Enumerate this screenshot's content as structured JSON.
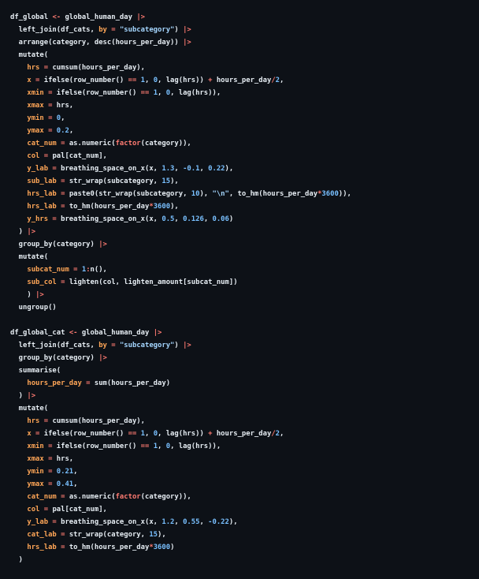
{
  "colors": {
    "background": "#0d1117",
    "plain": "#e6edf3",
    "argument": "#ffa657",
    "operator": "#ff7b72",
    "number": "#79c0ff",
    "string": "#a5d6ff",
    "function": "#d2a8ff"
  },
  "code": {
    "lines": [
      [
        [
          "var",
          "df_global "
        ],
        [
          "op",
          "<-"
        ],
        [
          "plain",
          " global_human_day "
        ],
        [
          "op",
          "|>"
        ]
      ],
      [
        [
          "plain",
          "  left_join(df_cats, "
        ],
        [
          "arg",
          "by"
        ],
        [
          "op",
          " = "
        ],
        [
          "str",
          "\"subcategory\""
        ],
        [
          "plain",
          ") "
        ],
        [
          "op",
          "|>"
        ]
      ],
      [
        [
          "plain",
          "  arrange(category, desc(hours_per_day)) "
        ],
        [
          "op",
          "|>"
        ]
      ],
      [
        [
          "plain",
          "  mutate("
        ]
      ],
      [
        [
          "plain",
          "    "
        ],
        [
          "arg",
          "hrs"
        ],
        [
          "op",
          " = "
        ],
        [
          "plain",
          "cumsum(hours_per_day),"
        ]
      ],
      [
        [
          "plain",
          "    "
        ],
        [
          "arg",
          "x"
        ],
        [
          "op",
          " = "
        ],
        [
          "plain",
          "ifelse(row_number() "
        ],
        [
          "op",
          "=="
        ],
        [
          "plain",
          " "
        ],
        [
          "num",
          "1"
        ],
        [
          "plain",
          ", "
        ],
        [
          "num",
          "0"
        ],
        [
          "plain",
          ", lag(hrs)) "
        ],
        [
          "op",
          "+"
        ],
        [
          "plain",
          " hours_per_day"
        ],
        [
          "op",
          "/"
        ],
        [
          "num",
          "2"
        ],
        [
          "plain",
          ","
        ]
      ],
      [
        [
          "plain",
          "    "
        ],
        [
          "arg",
          "xmin"
        ],
        [
          "op",
          " = "
        ],
        [
          "plain",
          "ifelse(row_number() "
        ],
        [
          "op",
          "=="
        ],
        [
          "plain",
          " "
        ],
        [
          "num",
          "1"
        ],
        [
          "plain",
          ", "
        ],
        [
          "num",
          "0"
        ],
        [
          "plain",
          ", lag(hrs)),"
        ]
      ],
      [
        [
          "plain",
          "    "
        ],
        [
          "arg",
          "xmax"
        ],
        [
          "op",
          " = "
        ],
        [
          "plain",
          "hrs,"
        ]
      ],
      [
        [
          "plain",
          "    "
        ],
        [
          "arg",
          "ymin"
        ],
        [
          "op",
          " = "
        ],
        [
          "num",
          "0"
        ],
        [
          "plain",
          ","
        ]
      ],
      [
        [
          "plain",
          "    "
        ],
        [
          "arg",
          "ymax"
        ],
        [
          "op",
          " = "
        ],
        [
          "num",
          "0.2"
        ],
        [
          "plain",
          ","
        ]
      ],
      [
        [
          "plain",
          "    "
        ],
        [
          "arg",
          "cat_num"
        ],
        [
          "op",
          " = "
        ],
        [
          "plain",
          "as.numeric("
        ],
        [
          "op",
          "factor"
        ],
        [
          "plain",
          "(category)),"
        ]
      ],
      [
        [
          "plain",
          "    "
        ],
        [
          "arg",
          "col"
        ],
        [
          "op",
          " = "
        ],
        [
          "plain",
          "pal[cat_num],"
        ]
      ],
      [
        [
          "plain",
          "    "
        ],
        [
          "arg",
          "y_lab"
        ],
        [
          "op",
          " = "
        ],
        [
          "plain",
          "breathing_space_on_x(x, "
        ],
        [
          "num",
          "1.3"
        ],
        [
          "plain",
          ", "
        ],
        [
          "num",
          "-0.1"
        ],
        [
          "plain",
          ", "
        ],
        [
          "num",
          "0.22"
        ],
        [
          "plain",
          "),"
        ]
      ],
      [
        [
          "plain",
          "    "
        ],
        [
          "arg",
          "sub_lab"
        ],
        [
          "op",
          " = "
        ],
        [
          "plain",
          "str_wrap(subcategory, "
        ],
        [
          "num",
          "15"
        ],
        [
          "plain",
          "),"
        ]
      ],
      [
        [
          "plain",
          "    "
        ],
        [
          "arg",
          "hrs_lab"
        ],
        [
          "op",
          " = "
        ],
        [
          "plain",
          "paste0(str_wrap(subcategory, "
        ],
        [
          "num",
          "10"
        ],
        [
          "plain",
          "), "
        ],
        [
          "str",
          "\"\\n\""
        ],
        [
          "plain",
          ", to_hm(hours_per_day"
        ],
        [
          "op",
          "*"
        ],
        [
          "num",
          "3600"
        ],
        [
          "plain",
          "))"
        ],
        [
          "plain",
          ","
        ]
      ],
      [
        [
          "plain",
          "    "
        ],
        [
          "arg",
          "hrs_lab"
        ],
        [
          "op",
          " = "
        ],
        [
          "plain",
          "to_hm(hours_per_day"
        ],
        [
          "op",
          "*"
        ],
        [
          "num",
          "3600"
        ],
        [
          "plain",
          "),"
        ]
      ],
      [
        [
          "plain",
          "    "
        ],
        [
          "arg",
          "y_hrs"
        ],
        [
          "op",
          " = "
        ],
        [
          "plain",
          "breathing_space_on_x(x, "
        ],
        [
          "num",
          "0.5"
        ],
        [
          "plain",
          ", "
        ],
        [
          "num",
          "0.126"
        ],
        [
          "plain",
          ", "
        ],
        [
          "num",
          "0.06"
        ],
        [
          "plain",
          ")"
        ]
      ],
      [
        [
          "plain",
          "  ) "
        ],
        [
          "op",
          "|>"
        ]
      ],
      [
        [
          "plain",
          "  group_by(category) "
        ],
        [
          "op",
          "|>"
        ]
      ],
      [
        [
          "plain",
          "  mutate("
        ]
      ],
      [
        [
          "plain",
          "    "
        ],
        [
          "arg",
          "subcat_num"
        ],
        [
          "op",
          " = "
        ],
        [
          "num",
          "1"
        ],
        [
          "op",
          ":"
        ],
        [
          "plain",
          "n(),"
        ]
      ],
      [
        [
          "plain",
          "    "
        ],
        [
          "arg",
          "sub_col"
        ],
        [
          "op",
          " = "
        ],
        [
          "plain",
          "lighten(col, lighten_amount[subcat_num])"
        ]
      ],
      [
        [
          "plain",
          "    ) "
        ],
        [
          "op",
          "|>"
        ]
      ],
      [
        [
          "plain",
          "  ungroup()"
        ]
      ],
      [],
      [
        [
          "var",
          "df_global_cat "
        ],
        [
          "op",
          "<-"
        ],
        [
          "plain",
          " global_human_day "
        ],
        [
          "op",
          "|>"
        ]
      ],
      [
        [
          "plain",
          "  left_join(df_cats, "
        ],
        [
          "arg",
          "by"
        ],
        [
          "op",
          " = "
        ],
        [
          "str",
          "\"subcategory\""
        ],
        [
          "plain",
          ") "
        ],
        [
          "op",
          "|>"
        ]
      ],
      [
        [
          "plain",
          "  group_by(category) "
        ],
        [
          "op",
          "|>"
        ]
      ],
      [
        [
          "plain",
          "  summarise("
        ]
      ],
      [
        [
          "plain",
          "    "
        ],
        [
          "arg",
          "hours_per_day"
        ],
        [
          "op",
          " = "
        ],
        [
          "plain",
          "sum(hours_per_day)"
        ]
      ],
      [
        [
          "plain",
          "  ) "
        ],
        [
          "op",
          "|>"
        ]
      ],
      [
        [
          "plain",
          "  mutate("
        ]
      ],
      [
        [
          "plain",
          "    "
        ],
        [
          "arg",
          "hrs"
        ],
        [
          "op",
          " = "
        ],
        [
          "plain",
          "cumsum(hours_per_day),"
        ]
      ],
      [
        [
          "plain",
          "    "
        ],
        [
          "arg",
          "x"
        ],
        [
          "op",
          " = "
        ],
        [
          "plain",
          "ifelse(row_number() "
        ],
        [
          "op",
          "=="
        ],
        [
          "plain",
          " "
        ],
        [
          "num",
          "1"
        ],
        [
          "plain",
          ", "
        ],
        [
          "num",
          "0"
        ],
        [
          "plain",
          ", lag(hrs)) "
        ],
        [
          "op",
          "+"
        ],
        [
          "plain",
          " hours_per_day"
        ],
        [
          "op",
          "/"
        ],
        [
          "num",
          "2"
        ],
        [
          "plain",
          ","
        ]
      ],
      [
        [
          "plain",
          "    "
        ],
        [
          "arg",
          "xmin"
        ],
        [
          "op",
          " = "
        ],
        [
          "plain",
          "ifelse(row_number() "
        ],
        [
          "op",
          "=="
        ],
        [
          "plain",
          " "
        ],
        [
          "num",
          "1"
        ],
        [
          "plain",
          ", "
        ],
        [
          "num",
          "0"
        ],
        [
          "plain",
          ", lag(hrs)),"
        ]
      ],
      [
        [
          "plain",
          "    "
        ],
        [
          "arg",
          "xmax"
        ],
        [
          "op",
          " = "
        ],
        [
          "plain",
          "hrs,"
        ]
      ],
      [
        [
          "plain",
          "    "
        ],
        [
          "arg",
          "ymin"
        ],
        [
          "op",
          " = "
        ],
        [
          "num",
          "0.21"
        ],
        [
          "plain",
          ","
        ]
      ],
      [
        [
          "plain",
          "    "
        ],
        [
          "arg",
          "ymax"
        ],
        [
          "op",
          " = "
        ],
        [
          "num",
          "0.41"
        ],
        [
          "plain",
          ","
        ]
      ],
      [
        [
          "plain",
          "    "
        ],
        [
          "arg",
          "cat_num"
        ],
        [
          "op",
          " = "
        ],
        [
          "plain",
          "as.numeric("
        ],
        [
          "op",
          "factor"
        ],
        [
          "plain",
          "(category)),"
        ]
      ],
      [
        [
          "plain",
          "    "
        ],
        [
          "arg",
          "col"
        ],
        [
          "op",
          " = "
        ],
        [
          "plain",
          "pal[cat_num],"
        ]
      ],
      [
        [
          "plain",
          "    "
        ],
        [
          "arg",
          "y_lab"
        ],
        [
          "op",
          " = "
        ],
        [
          "plain",
          "breathing_space_on_x(x, "
        ],
        [
          "num",
          "1.2"
        ],
        [
          "plain",
          ", "
        ],
        [
          "num",
          "0.55"
        ],
        [
          "plain",
          ", "
        ],
        [
          "num",
          "-0.22"
        ],
        [
          "plain",
          "),"
        ]
      ],
      [
        [
          "plain",
          "    "
        ],
        [
          "arg",
          "cat_lab"
        ],
        [
          "op",
          " = "
        ],
        [
          "plain",
          "str_wrap(category, "
        ],
        [
          "num",
          "15"
        ],
        [
          "plain",
          "),"
        ]
      ],
      [
        [
          "plain",
          "    "
        ],
        [
          "arg",
          "hrs_lab"
        ],
        [
          "op",
          " = "
        ],
        [
          "plain",
          "to_hm(hours_per_day"
        ],
        [
          "op",
          "*"
        ],
        [
          "num",
          "3600"
        ],
        [
          "plain",
          ")"
        ]
      ],
      [
        [
          "plain",
          "  )"
        ]
      ]
    ]
  }
}
